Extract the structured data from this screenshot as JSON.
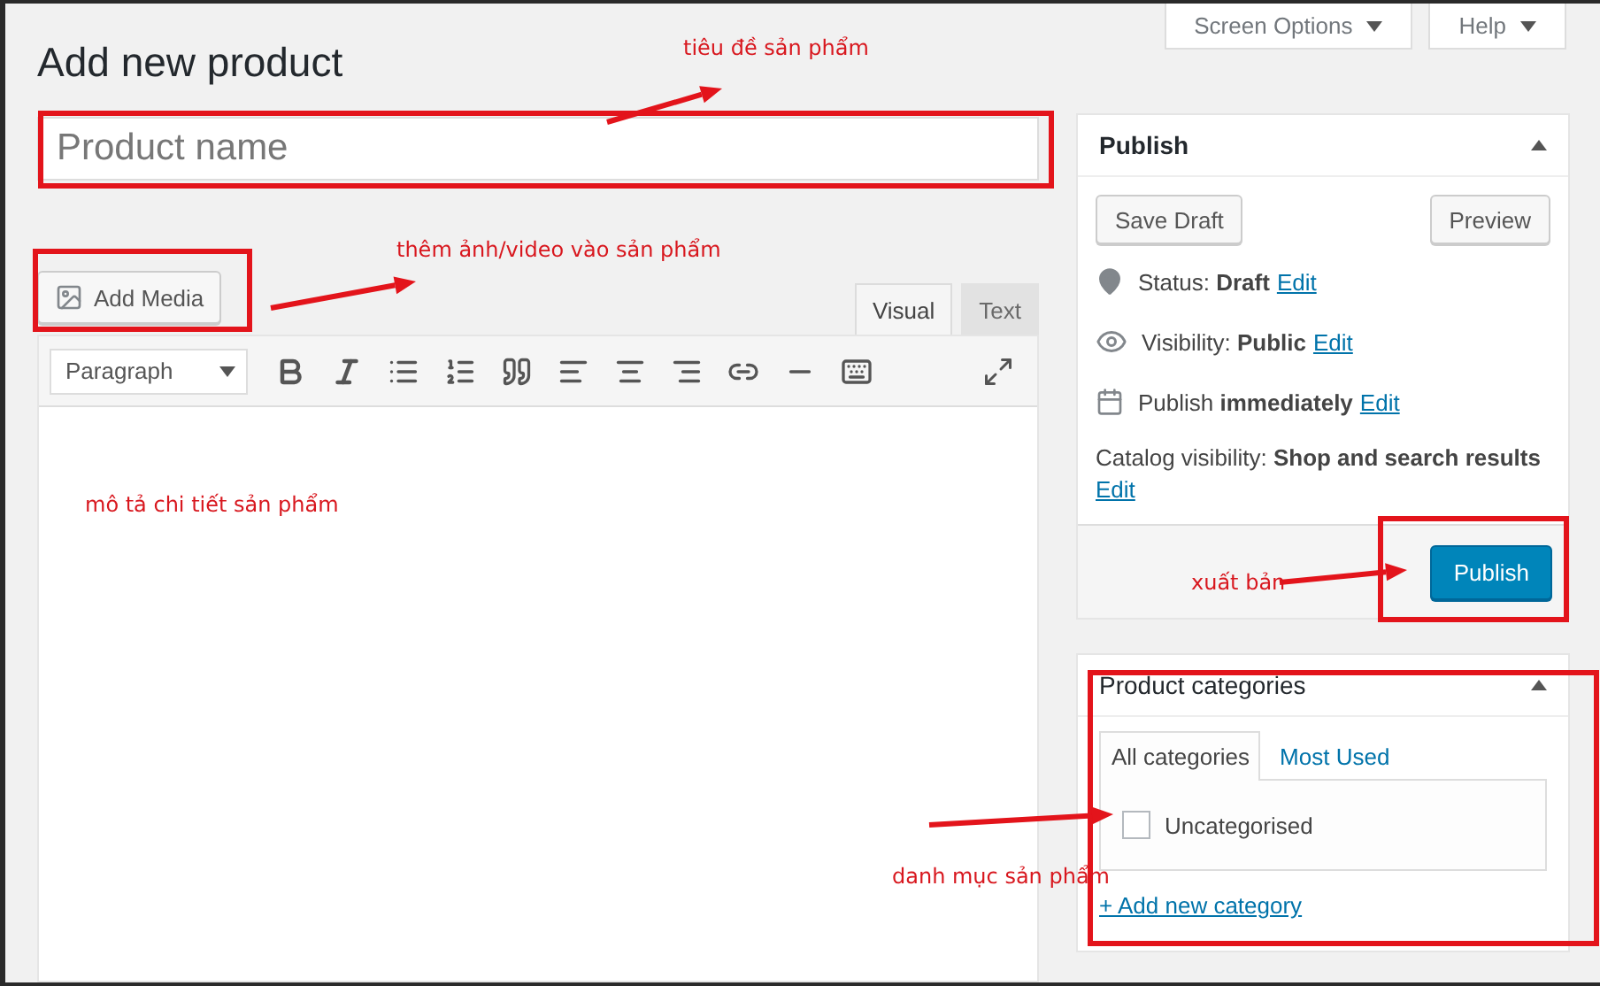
{
  "header": {
    "screen_options": "Screen Options",
    "help": "Help"
  },
  "title": "Add new product",
  "title_field": {
    "placeholder": "Product name"
  },
  "add_media": "Add Media",
  "editor_tabs": [
    {
      "label": "Visual",
      "selected": true
    },
    {
      "label": "Text",
      "selected": false
    }
  ],
  "format_select": "Paragraph",
  "publish": {
    "title": "Publish",
    "save_draft": "Save Draft",
    "preview": "Preview",
    "rows": [
      {
        "kind": "status",
        "label": "Status:",
        "value": "Draft",
        "link": "Edit"
      },
      {
        "kind": "visibility",
        "label": "Visibility:",
        "value": "Public",
        "link": "Edit"
      },
      {
        "kind": "schedule",
        "label": "Publish",
        "value": "immediately",
        "link": "Edit"
      }
    ],
    "catalog": {
      "label": "Catalog visibility:",
      "value": "Shop and search results",
      "link": "Edit"
    },
    "button": "Publish"
  },
  "categories": {
    "title": "Product categories",
    "tabs": [
      {
        "label": "All categories",
        "selected": true
      },
      {
        "label": "Most Used",
        "selected": false
      }
    ],
    "items": [
      {
        "label": "Uncategorised",
        "checked": false
      }
    ],
    "add_link": "+ Add new category"
  },
  "notes": [
    "tiêu đề sản phẩm",
    "thêm ảnh/video vào sản phẩm",
    "mô tả chi tiết sản phẩm",
    "xuất bản",
    "danh mục sản phẩm"
  ]
}
